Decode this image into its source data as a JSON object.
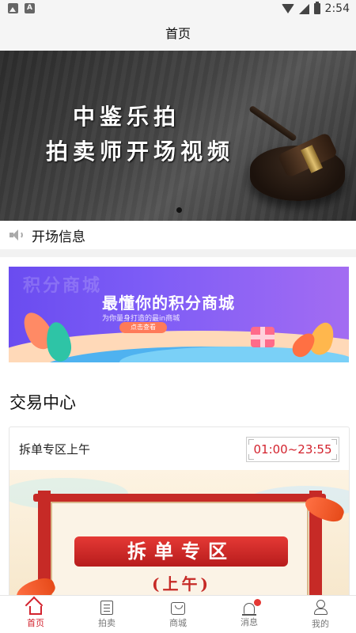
{
  "status_bar": {
    "time": "2:54"
  },
  "header": {
    "title": "首页"
  },
  "banner": {
    "line1": "中鉴乐拍",
    "line2": "拍卖师开场视频"
  },
  "notice": {
    "text": "开场信息"
  },
  "promo": {
    "watermark": "积分商城",
    "title": "最懂你的积分商城",
    "subtitle": "为你量身打造的最in商城",
    "button": "点击查看"
  },
  "trade_center": {
    "title": "交易中心",
    "card": {
      "title": "拆单专区上午",
      "time": "01:00~23:55",
      "image_title": "拆单专区",
      "image_subtitle": "(上午)"
    }
  },
  "tabbar": {
    "items": [
      {
        "label": "首页",
        "icon": "home-icon",
        "active": true
      },
      {
        "label": "拍卖",
        "icon": "list-icon"
      },
      {
        "label": "商城",
        "icon": "bag-icon"
      },
      {
        "label": "消息",
        "icon": "bell-icon",
        "badge": true
      },
      {
        "label": "我的",
        "icon": "user-icon"
      }
    ]
  },
  "colors": {
    "accent": "#d3232e"
  }
}
